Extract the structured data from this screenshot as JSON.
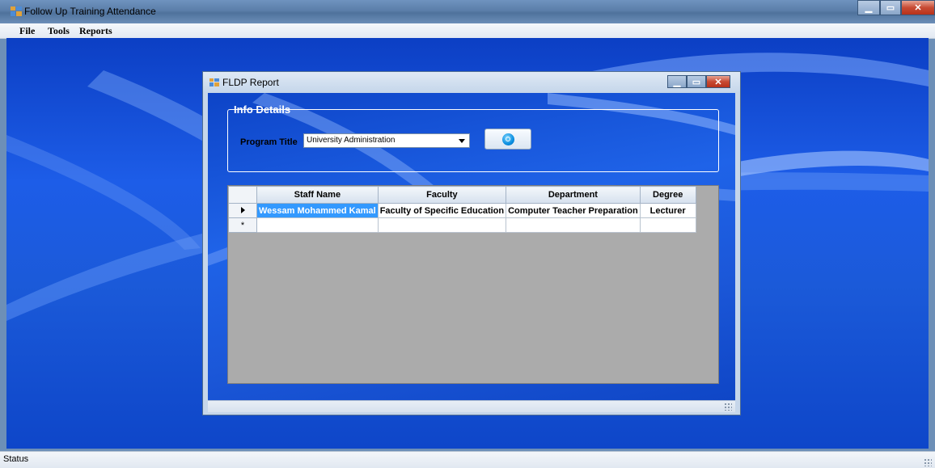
{
  "window": {
    "title": "Follow Up Training Attendance"
  },
  "menu": {
    "file": "File",
    "tools": "Tools",
    "reports": "Reports"
  },
  "child_window": {
    "title": "FLDP Report",
    "group_title": "Info Details",
    "program_title_label": "Program Title",
    "program_title_value": "University Administration"
  },
  "grid": {
    "columns": [
      "Staff Name",
      "Faculty",
      "Department",
      "Degree"
    ],
    "rows": [
      [
        "Wessam Mohammed Kamal",
        "Faculty  of Specific Education",
        "Computer Teacher Preparation",
        "Lecturer"
      ]
    ],
    "new_row_marker": "*"
  },
  "status": {
    "text": "Status"
  },
  "icons": [
    "app-icon",
    "minimize-icon",
    "maximize-icon",
    "close-icon",
    "search-icon",
    "dropdown-arrow-icon",
    "row-pointer-icon",
    "size-grip-icon"
  ]
}
